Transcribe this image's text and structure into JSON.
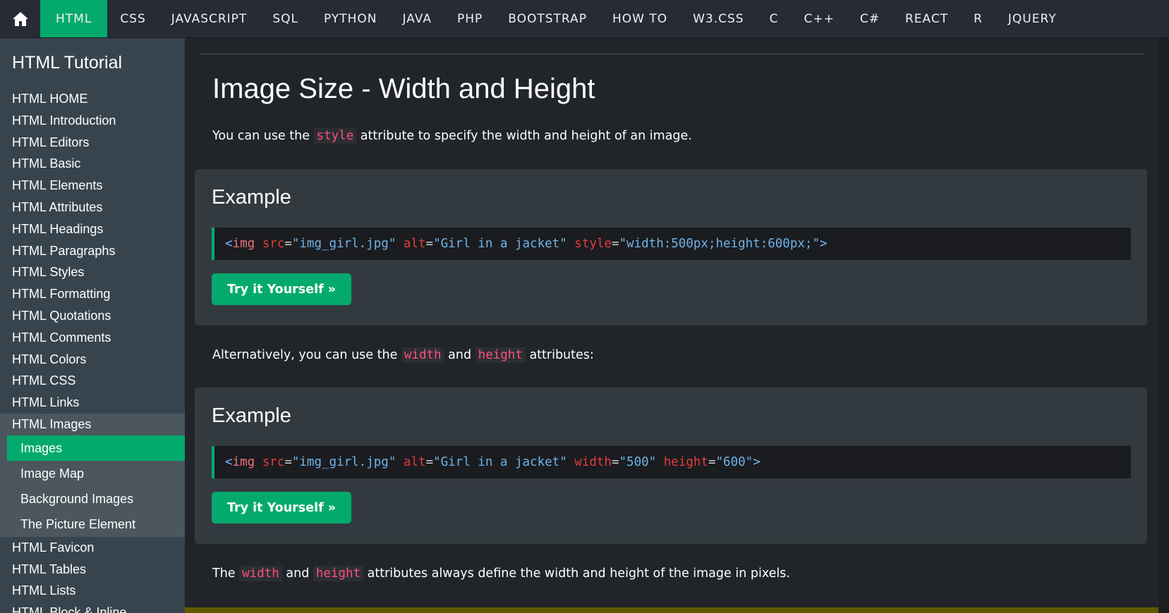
{
  "topnav": {
    "home_icon": "home-icon",
    "items": [
      "HTML",
      "CSS",
      "JAVASCRIPT",
      "SQL",
      "PYTHON",
      "JAVA",
      "PHP",
      "BOOTSTRAP",
      "HOW TO",
      "W3.CSS",
      "C",
      "C++",
      "C#",
      "REACT",
      "R",
      "JQUERY"
    ],
    "active": "HTML"
  },
  "sidebar": {
    "title": "HTML Tutorial",
    "items_before": [
      "HTML HOME",
      "HTML Introduction",
      "HTML Editors",
      "HTML Basic",
      "HTML Elements",
      "HTML Attributes",
      "HTML Headings",
      "HTML Paragraphs",
      "HTML Styles",
      "HTML Formatting",
      "HTML Quotations",
      "HTML Comments",
      "HTML Colors",
      "HTML CSS",
      "HTML Links"
    ],
    "open_section": "HTML Images",
    "sub_items": [
      "Images",
      "Image Map",
      "Background Images",
      "The Picture Element"
    ],
    "active_sub": "Images",
    "items_after": [
      "HTML Favicon",
      "HTML Tables",
      "HTML Lists",
      "HTML Block & Inline"
    ]
  },
  "main": {
    "title": "Image Size - Width and Height",
    "intro": {
      "before": "You can use the ",
      "code": "style",
      "after": " attribute to specify the width and height of an image."
    },
    "example1": {
      "title": "Example",
      "code": {
        "open": "<",
        "tag": "img",
        "a1": "src",
        "v1": "\"img_girl.jpg\"",
        "a2": "alt",
        "v2": "\"Girl in a jacket\"",
        "a3": "style",
        "v3": "\"width:500px;height:600px;\"",
        "close": ">"
      },
      "button": "Try it Yourself »"
    },
    "alt_para": {
      "before": "Alternatively, you can use the ",
      "code1": "width",
      "mid": " and ",
      "code2": "height",
      "after": " attributes:"
    },
    "example2": {
      "title": "Example",
      "code": {
        "open": "<",
        "tag": "img",
        "a1": "src",
        "v1": "\"img_girl.jpg\"",
        "a2": "alt",
        "v2": "\"Girl in a jacket\"",
        "a3": "width",
        "v3": "\"500\"",
        "a4": "height",
        "v4": "\"600\"",
        "close": ">"
      },
      "button": "Try it Yourself »"
    },
    "final_para": {
      "before": "The ",
      "code1": "width",
      "mid": " and ",
      "code2": "height",
      "after": " attributes always define the width and height of the image in pixels."
    }
  },
  "colors": {
    "accent": "#04aa6d",
    "nav_bg": "#282a35",
    "sidebar_bg": "#38444d",
    "main_bg": "#212529",
    "code_pink": "#ff4f7b"
  }
}
